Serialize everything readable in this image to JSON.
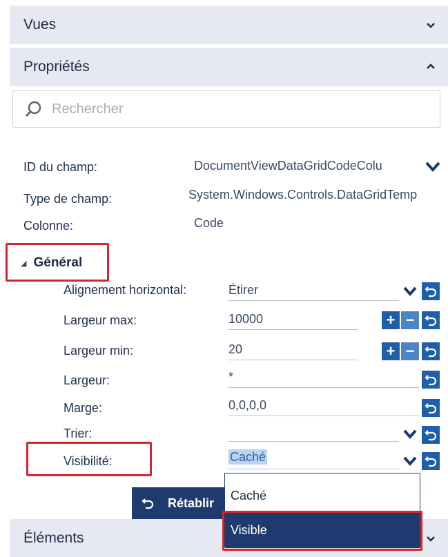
{
  "sections": {
    "views": "Vues",
    "properties": "Propriétés",
    "elements": "Éléments"
  },
  "search": {
    "placeholder": "Rechercher"
  },
  "fields": [
    {
      "label": "ID du champ:",
      "value": "DocumentViewDataGridCodeColu"
    },
    {
      "label": "Type de champ:",
      "value": "System.Windows.Controls.DataGridTemp"
    },
    {
      "label": "Colonne:",
      "value": "Code"
    }
  ],
  "general": {
    "title": "Général",
    "rows": [
      {
        "label": "Alignement horizontal:",
        "value": "Étirer"
      },
      {
        "label": "Largeur max:",
        "value": "10000"
      },
      {
        "label": "Largeur min:",
        "value": "20"
      },
      {
        "label": "Largeur:",
        "value": "*"
      },
      {
        "label": "Marge:",
        "value": "0,0,0,0"
      },
      {
        "label": "Trier:",
        "value": ""
      },
      {
        "label": "Visibilité:",
        "value": "Caché"
      }
    ]
  },
  "dropdown": {
    "options": [
      "Caché",
      "Visible"
    ],
    "highlighted": "Visible"
  },
  "reset_button": {
    "label": "Rétablir"
  },
  "colors": {
    "accent": "#1f5ea8",
    "dark": "#1f3a6e",
    "highlight_border": "#d4262c",
    "header_bg": "#e6e9f2"
  }
}
